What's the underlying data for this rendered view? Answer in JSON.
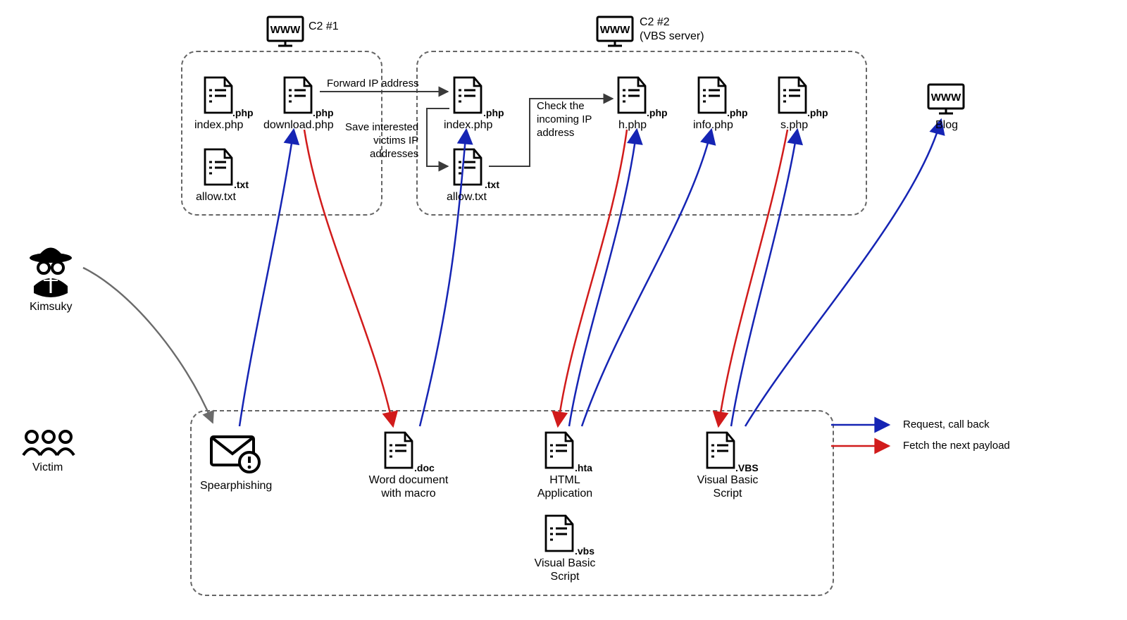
{
  "tag_line": "Kimsuky",
  "victim_label": "Victim",
  "spearphishing_label": "Spearphishing",
  "doc_label": "Word document\nwith macro",
  "hta_label": "HTML\nApplication",
  "vbs_small_label": "Visual Basic\nScript",
  "vbs_big_label": "Visual Basic\nScript",
  "blog_label": "Blog",
  "c2_1_label": "C2 #1",
  "c2_2_label": "C2 #2\n(VBS server)",
  "files_c2_1": {
    "index": "index.php",
    "download": "download.php",
    "allow": "allow.txt"
  },
  "files_c2_2": {
    "index": "index.php",
    "allow": "allow.txt",
    "h": "h.php",
    "info": "info.php",
    "s": "s.php"
  },
  "ext": {
    "php": ".php",
    "txt": ".txt",
    "doc": ".doc",
    "hta": ".hta",
    "vbs_low": ".vbs",
    "vbs_up": ".VBS"
  },
  "arrow_labels": {
    "forward_ip": "Forward IP address",
    "save_ips": "Save interested\nvictims IP\naddresses",
    "check_ip": "Check the\nincoming IP\naddress"
  },
  "legend": {
    "request": "Request, call back",
    "fetch": "Fetch the next payload"
  }
}
